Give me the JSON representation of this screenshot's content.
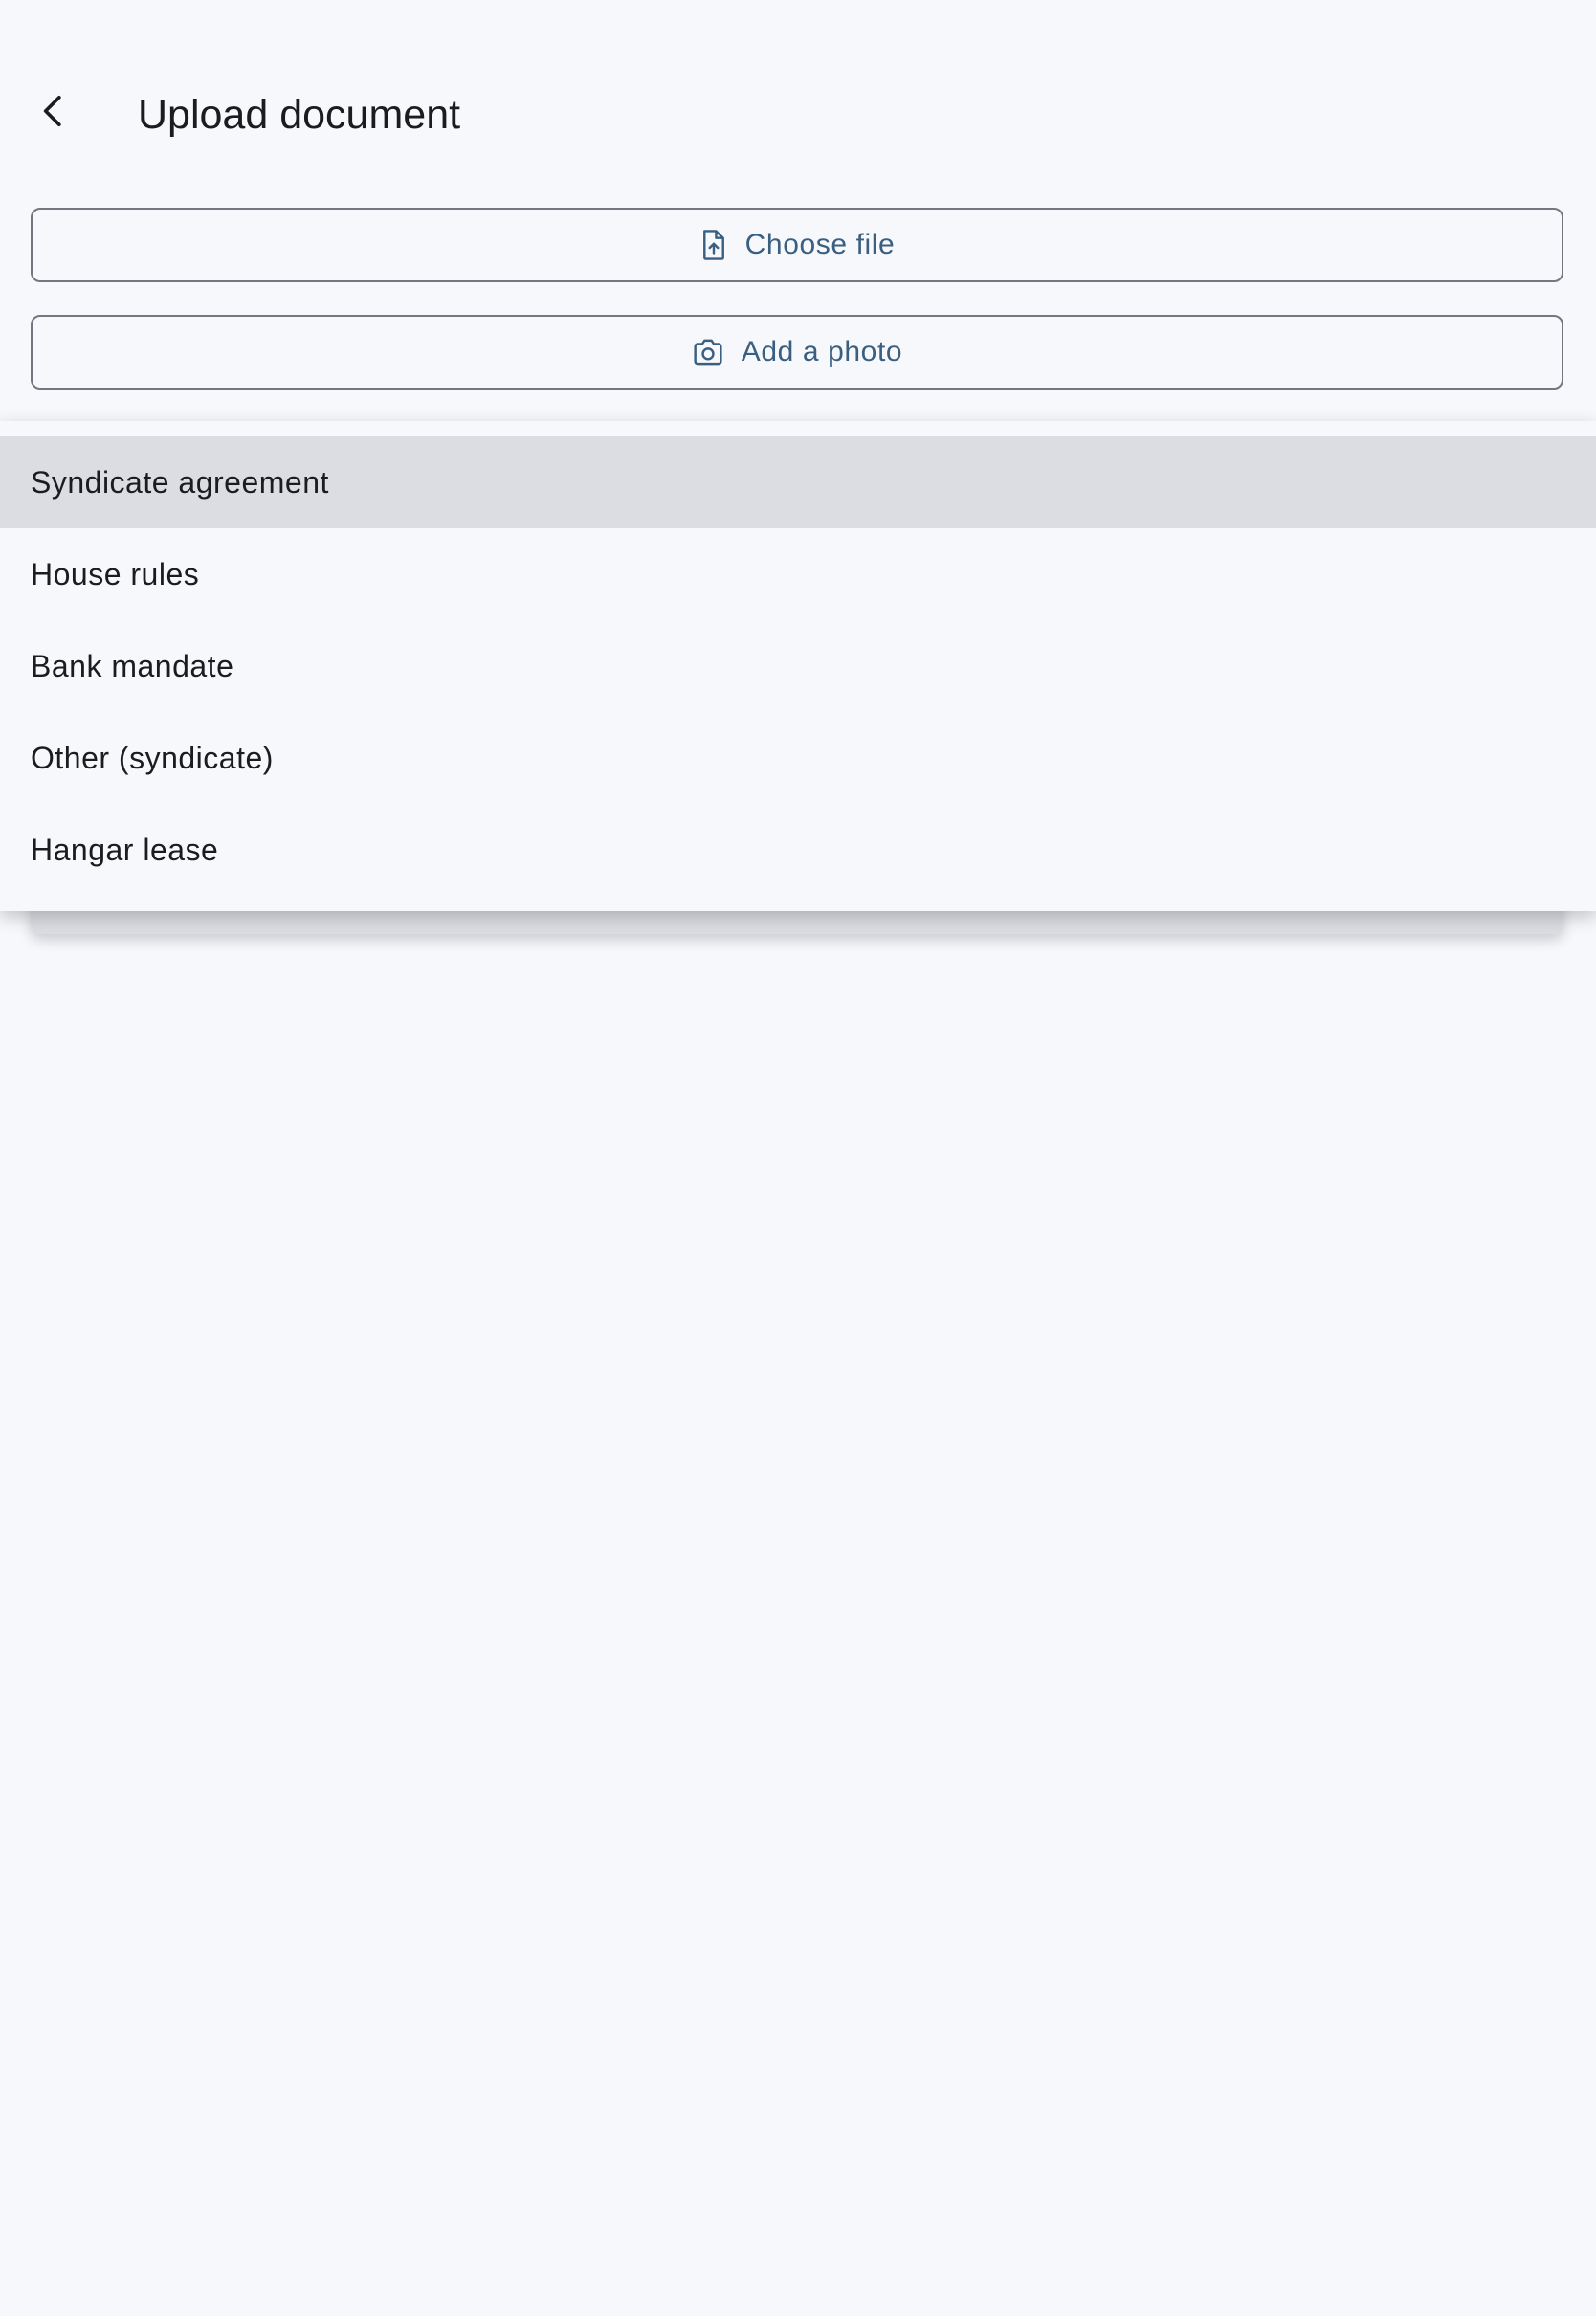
{
  "header": {
    "title": "Upload document",
    "back_icon": "chevron-left-icon"
  },
  "actions": {
    "choose_file": {
      "label": "Choose file",
      "icon": "file-upload-icon"
    },
    "add_photo": {
      "label": "Add a photo",
      "icon": "camera-icon"
    }
  },
  "menu": {
    "selected_index": 0,
    "items": [
      {
        "label": "Syndicate agreement"
      },
      {
        "label": "House rules"
      },
      {
        "label": "Bank mandate"
      },
      {
        "label": "Other (syndicate)"
      },
      {
        "label": "Hangar lease"
      }
    ]
  },
  "colors": {
    "background": "#f7f8fc",
    "accent": "#3a5f80",
    "outline": "#74777f",
    "selected_item": "#dcdde2",
    "text": "#1b1c20"
  }
}
